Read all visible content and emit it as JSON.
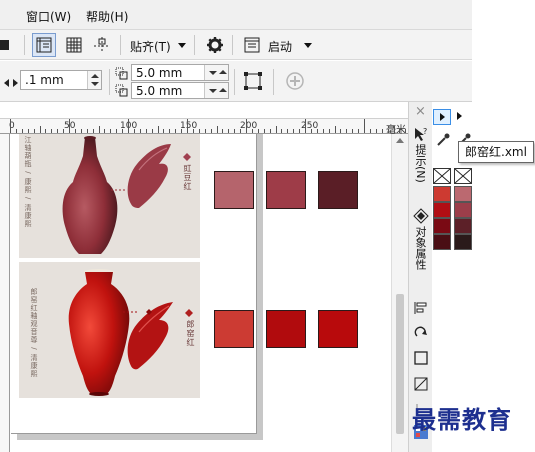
{
  "menubar": {
    "items": [
      {
        "label": "窗口(W)",
        "underline": "W"
      },
      {
        "label": "帮助(H)",
        "underline": "H"
      }
    ]
  },
  "toolbar1": {
    "snap_label": "贴齐(T)",
    "launch_label": "启动"
  },
  "propertybar": {
    "outline_width": ".1 mm",
    "dup_x": "5.0 mm",
    "dup_y": "5.0 mm"
  },
  "ruler": {
    "labels": [
      "0",
      "50",
      "100",
      "150",
      "200",
      "250"
    ],
    "unit": "毫米"
  },
  "canvas": {
    "card1_caption": "豇豆红",
    "card1_side_text": "江轴葫瓶 / 康熙 / 清康熙",
    "card2_caption": "郎窑红",
    "card2_side_text": "郎窑红釉观音尊 / 清康熙",
    "row1_swatches": [
      "#b5646c",
      "#9e3c48",
      "#5a1e26"
    ],
    "row2_swatches": [
      "#cc3b33",
      "#b10b0d",
      "#b80a0c"
    ]
  },
  "docker": {
    "tab_hints": "提示(N)",
    "tab_object_properties": "对象属性"
  },
  "palette": {
    "tooltip": "郎窑红.xml",
    "col1_colors": [
      "#cd3a31",
      "#b10e14",
      "#7a0a14",
      "#4a0e14"
    ],
    "col2_colors": [
      "#bb6970",
      "#9c3e4a",
      "#5c2028",
      "#2a1a1a"
    ]
  },
  "watermark": "最需教育",
  "colors": {
    "accent": "#3a8ee6",
    "watermark": "#1d2f8f"
  }
}
